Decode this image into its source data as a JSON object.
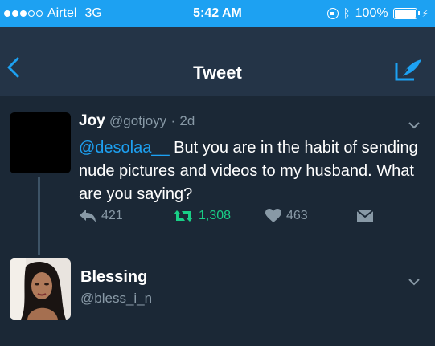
{
  "status_bar": {
    "carrier": "Airtel",
    "network": "3G",
    "time": "5:42 AM",
    "battery": "100%",
    "battery_level": 1.0,
    "signal_bars_filled": 3,
    "signal_bars_total": 5,
    "icons": [
      "lock-rotation-icon",
      "bluetooth-icon",
      "battery-icon",
      "charging-icon"
    ]
  },
  "nav": {
    "title": "Tweet",
    "back_icon": "chevron-left-icon",
    "compose_icon": "compose-tweet-icon"
  },
  "tweet": {
    "name": "Joy",
    "handle": "@gotjoyy",
    "separator": "·",
    "age": "2d",
    "mention": "@desolaa__",
    "text": " But you are in the habit of sending nude pictures and videos to my husband. What are you saying?",
    "actions": {
      "reply_count": "421",
      "retweet_count": "1,308",
      "like_count": "463"
    }
  },
  "reply": {
    "name": "Blessing",
    "handle": "@bless_i_n"
  },
  "colors": {
    "status_bar_bg": "#1da1f2",
    "nav_bg": "#243447",
    "body_bg": "#1b2836",
    "accent": "#1da1f2",
    "retweet_green": "#19cf86",
    "muted": "#8899a6"
  }
}
